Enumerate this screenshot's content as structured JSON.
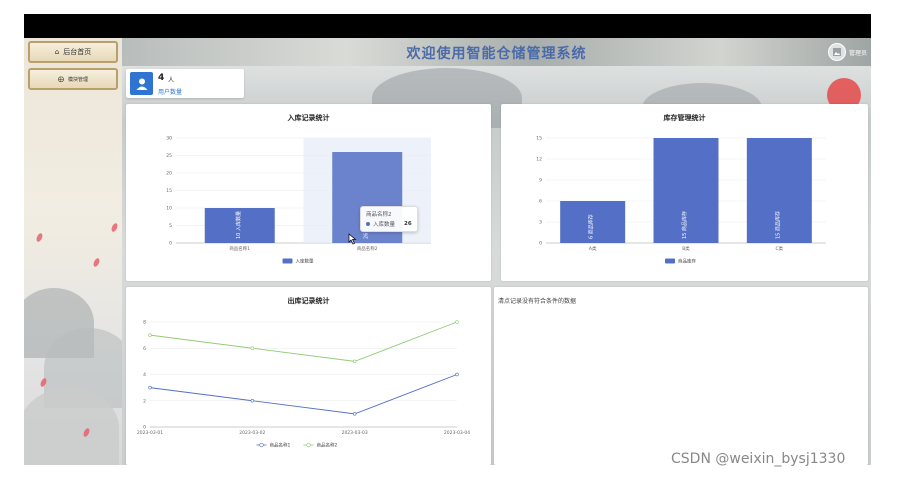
{
  "sidebar": {
    "items": [
      {
        "label": "后台首页",
        "icon": "home-icon"
      },
      {
        "label": "模块管理",
        "icon": "grid-icon"
      }
    ]
  },
  "header": {
    "title": "欢迎使用智能仓储管理系统",
    "admin_label": "管理员",
    "avatar_icon": "user-avatar-icon"
  },
  "stat_card": {
    "value": "4",
    "unit": "人",
    "label": "用户数量",
    "icon": "user-icon",
    "color": "#2f74d0"
  },
  "colors": {
    "series1": "#5470c6",
    "series2": "#91cc75",
    "sun": "#e54a4a",
    "banner_title": "#4a6aa8"
  },
  "inbound_chart": {
    "title": "入库记录统计",
    "tooltip": {
      "title": "商品名称2",
      "series": "入库数量",
      "value": "26"
    },
    "chart_data": {
      "type": "bar",
      "categories": [
        "商品名称1",
        "商品名称2"
      ],
      "series": [
        {
          "name": "入库数量",
          "values": [
            10,
            26
          ]
        }
      ],
      "ylim": [
        0,
        30
      ],
      "yticks": [
        0,
        5,
        10,
        15,
        20,
        25,
        30
      ],
      "grid": true,
      "legend": "bottom"
    }
  },
  "inventory_chart": {
    "title": "库存管理统计",
    "chart_data": {
      "type": "bar",
      "categories": [
        "A类",
        "B类",
        "C类"
      ],
      "series": [
        {
          "name": "商品库存",
          "values": [
            6,
            15,
            15
          ]
        }
      ],
      "ylim": [
        0,
        15
      ],
      "yticks": [
        0,
        3,
        6,
        9,
        12,
        15
      ],
      "grid": true,
      "legend": "bottom"
    }
  },
  "outbound_chart": {
    "title": "出库记录统计",
    "chart_data": {
      "type": "line",
      "categories": [
        "2023-03-01",
        "2023-03-02",
        "2023-03-03",
        "2023-03-04"
      ],
      "series": [
        {
          "name": "商品名称1",
          "values": [
            3,
            2,
            1,
            4
          ]
        },
        {
          "name": "商品名称2",
          "values": [
            7,
            6,
            5,
            8
          ]
        }
      ],
      "ylim": [
        0,
        8
      ],
      "yticks": [
        0,
        2,
        4,
        6,
        8
      ],
      "grid": true,
      "legend": "bottom"
    }
  },
  "empty_panel": {
    "text": "清点记录没有符合条件的数据"
  },
  "watermark": "CSDN @weixin_bysj1330"
}
